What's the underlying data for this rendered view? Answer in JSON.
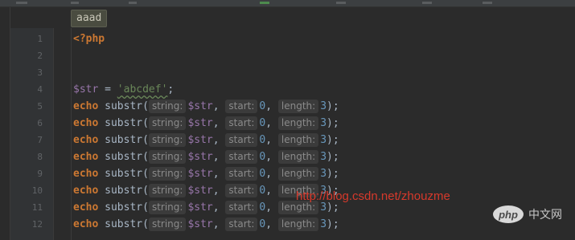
{
  "breadcrumb": "aaad",
  "lines": [
    {
      "n": "1"
    },
    {
      "n": "2"
    },
    {
      "n": "3"
    },
    {
      "n": "4"
    },
    {
      "n": "5"
    },
    {
      "n": "6"
    },
    {
      "n": "7"
    },
    {
      "n": "8"
    },
    {
      "n": "9"
    },
    {
      "n": "10"
    },
    {
      "n": "11"
    },
    {
      "n": "12"
    }
  ],
  "code": {
    "php_open": "<?php",
    "assign_var": "$str",
    "assign_op": " = ",
    "assign_str": "'abcdef'",
    "semicolon": ";",
    "echo_kw": "echo",
    "func": " substr(",
    "hint_string": "string:",
    "arg_var": "$str",
    "comma": ",",
    "hint_start": "start:",
    "arg_start": "0",
    "hint_length": "length:",
    "arg_length": "3",
    "close": ");"
  },
  "watermark": "http://blog.csdn.net/zhouzme",
  "logo": {
    "mark": "php",
    "text": "中文网"
  },
  "colors": {
    "background": "#2b2b2b",
    "keyword": "#cc7832",
    "variable": "#9876aa",
    "string": "#6a8759",
    "number": "#6897bb",
    "watermark": "#e03a2c"
  }
}
